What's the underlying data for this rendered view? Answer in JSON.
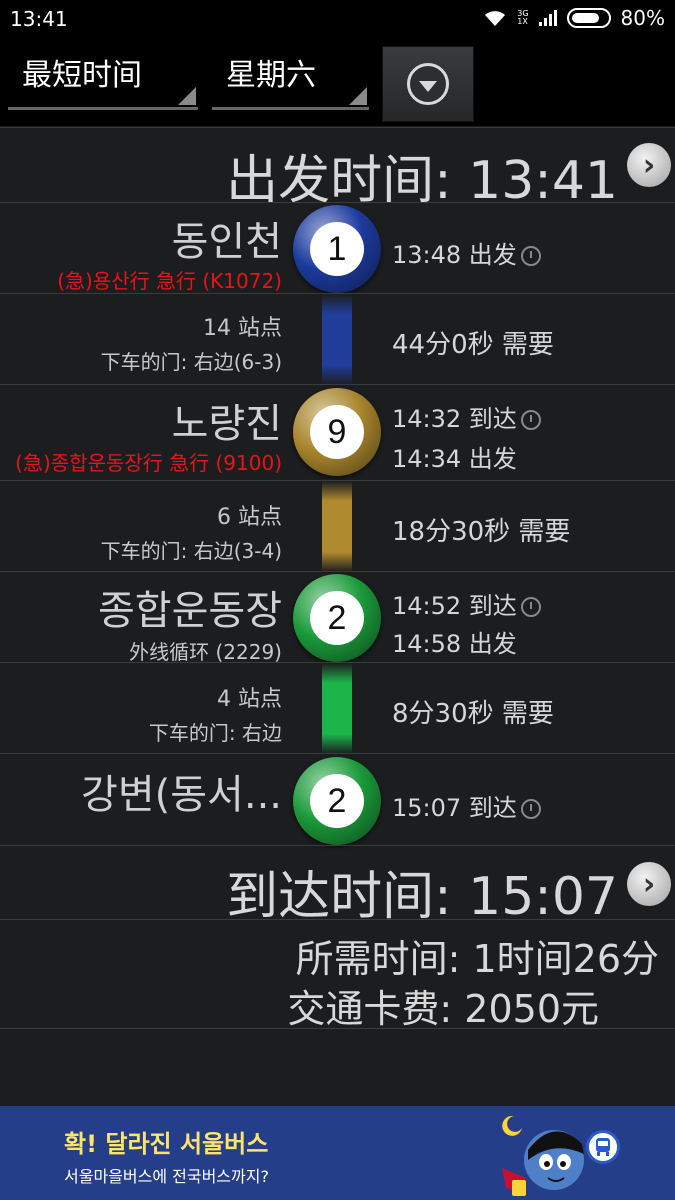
{
  "status": {
    "time": "13:41",
    "battery": "80%",
    "battery_level": 0.8,
    "net_top": "3G",
    "net_bottom": "1X"
  },
  "toolbar": {
    "mode": "最短时间",
    "day": "星期六",
    "dropdown_icon": "dropdown-icon"
  },
  "departure": {
    "label": "出发时间: 13:41"
  },
  "stops": [
    {
      "name": "동인천",
      "line_number": "1",
      "line_color": "#1d3b9e",
      "train": "(急)용산行 急行 (K1072)",
      "times": [
        "13:48 出发"
      ]
    },
    {
      "name": "노량진",
      "line_number": "9",
      "line_color": "#a8852c",
      "train": "(急)종합운동장行 急行 (9100)",
      "times": [
        "14:32 到达",
        "14:34 出发"
      ]
    },
    {
      "name": "종합운동장",
      "line_number": "2",
      "line_color": "#1b9a3a",
      "sub": "外线循环 (2229)",
      "times": [
        "14:52 到达",
        "14:58 出发"
      ]
    },
    {
      "name": "강변(동서...",
      "line_number": "2",
      "line_color": "#1b9a3a",
      "times": [
        "15:07 到达"
      ]
    }
  ],
  "segments": [
    {
      "stops": "14 站点",
      "door": "下车的门: 右边(6-3)",
      "duration": "44分0秒 需要",
      "color": "#213e9a"
    },
    {
      "stops": "6 站点",
      "door": "下车的门: 右边(3-4)",
      "duration": "18分30秒 需要",
      "color": "#b08a2e"
    },
    {
      "stops": "4 站点",
      "door": "下车的门: 右边",
      "duration": "8分30秒 需要",
      "color": "#1cb54a"
    }
  ],
  "arrival": {
    "label": "到达时间: 15:07"
  },
  "summary": {
    "total_time": "所需时间: 1时间26分",
    "fare": "交通卡费: 2050元"
  },
  "ad": {
    "title": "확! 달라진 서울버스",
    "subtitle": "서울마을버스에 전국버스까지?"
  }
}
